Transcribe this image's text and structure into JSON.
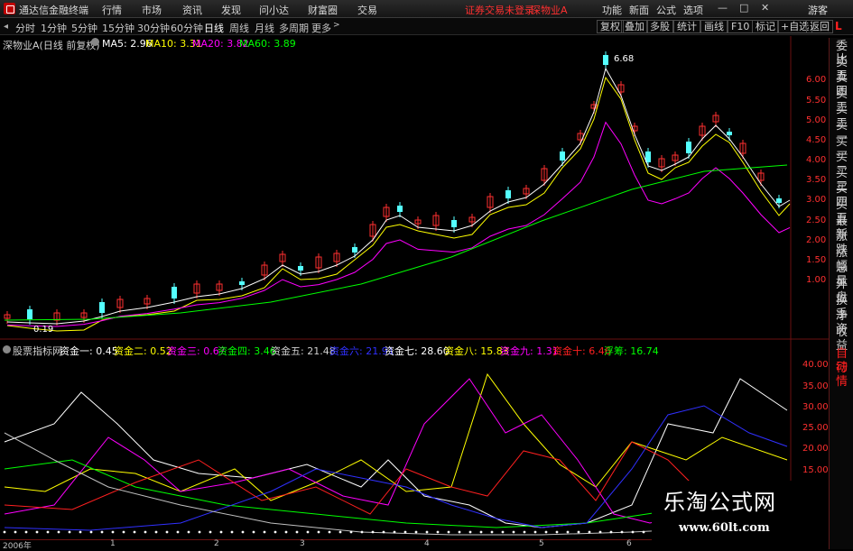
{
  "app": {
    "title": "通达信金融终端"
  },
  "menu": [
    "行情",
    "市场",
    "资讯",
    "发现",
    "问小达",
    "财富圈",
    "交易"
  ],
  "notice": {
    "trade_status": "证券交易未登录",
    "stock": "深物业A"
  },
  "right_menu": [
    "功能",
    "新面",
    "公式",
    "选项"
  ],
  "guest": "游客",
  "periods": [
    "分时",
    "1分钟",
    "5分钟",
    "15分钟",
    "30分钟",
    "60分钟",
    "日线",
    "周线",
    "月线",
    "多周期",
    "更多"
  ],
  "active_period": "日线",
  "tools": [
    "复权",
    "叠加",
    "多股",
    "统计",
    "画线",
    "F10",
    "标记",
    "+自选",
    "返回"
  ],
  "main": {
    "stock_label": "深物业A(日线 前复权)",
    "ma": [
      {
        "label": "MA5: 2.96",
        "color": "#ffffff"
      },
      {
        "label": "MA10: 3.31",
        "color": "#ffff00"
      },
      {
        "label": "MA20: 3.82",
        "color": "#ff00ff"
      },
      {
        "label": "MA60: 3.89",
        "color": "#00ff00"
      }
    ],
    "high_label": "6.68",
    "low_label": "0.19",
    "axis": [
      "6.00",
      "5.50",
      "5.00",
      "4.50",
      "4.00",
      "3.50",
      "3.00",
      "2.50",
      "2.00",
      "1.50",
      "1.00"
    ]
  },
  "indicator": {
    "name": "股票指标网",
    "items": [
      {
        "label": "资金一: 0.45",
        "color": "#ffffff"
      },
      {
        "label": "资金二: 0.52",
        "color": "#ffff00"
      },
      {
        "label": "资金三: 0.67",
        "color": "#ff00ff"
      },
      {
        "label": "资金四: 3.46",
        "color": "#00ff00"
      },
      {
        "label": "资金五: 21.48",
        "color": "#d0d0d0"
      },
      {
        "label": "资金六: 21.91",
        "color": "#3030ff"
      },
      {
        "label": "资金七: 28.60",
        "color": "#ffffff"
      },
      {
        "label": "资金八: 15.83",
        "color": "#ffff00"
      },
      {
        "label": "资金九: 1.31",
        "color": "#ff00ff"
      },
      {
        "label": "资金十: 6.46",
        "color": "#ff2020"
      },
      {
        "label": "浮筹: 16.74",
        "color": "#00ff00"
      }
    ],
    "axis": [
      "40.00",
      "35.00",
      "30.00",
      "25.00",
      "20.00",
      "15.00"
    ]
  },
  "right_tabs": [
    "委比",
    "卖五",
    "卖四",
    "卖三",
    "卖二",
    "卖一",
    "买一",
    "买二",
    "买三",
    "买四",
    "买五",
    "最新",
    "涨跌",
    "涨幅",
    "总量",
    "外盘",
    "换手",
    "净资",
    "收益"
  ],
  "bottom_tabs": [
    "自动",
    "行情"
  ],
  "dates": [
    "2006年",
    "1",
    "2",
    "3",
    "4",
    "5",
    "6"
  ],
  "watermark": {
    "title": "乐淘公式网",
    "url": "www.60lt.com"
  }
}
